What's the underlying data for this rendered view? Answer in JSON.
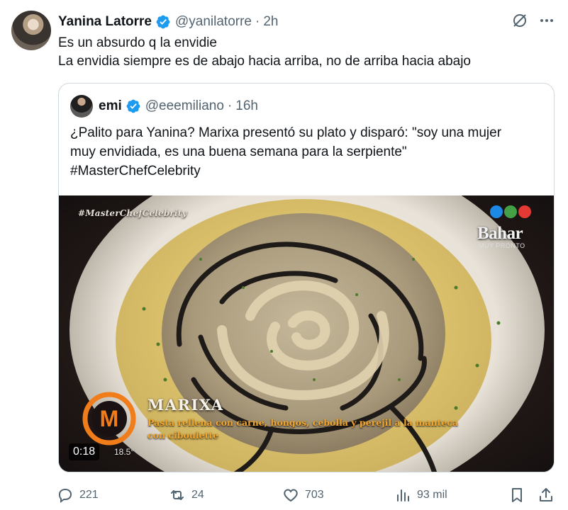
{
  "author": {
    "name": "Yanina Latorre",
    "handle": "@yanilatorre",
    "time": "2h"
  },
  "tweet": {
    "line1": "Es un absurdo q la envidie",
    "line2": "La envidia siempre es de abajo hacia arriba, no de arriba hacia abajo"
  },
  "quote": {
    "name": "emi",
    "handle": "@eeemiliano",
    "time": "16h",
    "line1": "¿Palito para Yanina? Marixa presentó su plato y disparó: \"soy una mujer",
    "line2": "muy envidiada, es una buena semana para la serpiente\"",
    "line3": "#MasterChefCelebrity"
  },
  "video": {
    "overlay_hashtag": "#MasterChefCelebrity",
    "promo_title": "Bahar",
    "promo_sub": "MUY PRONTO",
    "participant": "MARIXA",
    "dish_line1": "Pasta rellena con carne, hongos, cebolla y perejil a la manteca",
    "dish_line2": "con ciboulette",
    "logo_letter": "M",
    "duration": "0:18",
    "temperature": "18.5°"
  },
  "actions": {
    "replies": "221",
    "reposts": "24",
    "likes": "703",
    "views": "93 mil"
  },
  "icons": {
    "verified": "verified-badge-icon",
    "grok": "grok-icon",
    "more": "more-icon",
    "reply": "reply-icon",
    "repost": "repost-icon",
    "like": "like-icon",
    "views": "views-icon",
    "bookmark": "bookmark-icon",
    "share": "share-icon"
  },
  "colors": {
    "verified": "#1d9bf0",
    "text": "#0f1419",
    "muted": "#536471",
    "border": "#cfd9de",
    "caption": "#f3a52b",
    "logo": "#f07c1a"
  }
}
